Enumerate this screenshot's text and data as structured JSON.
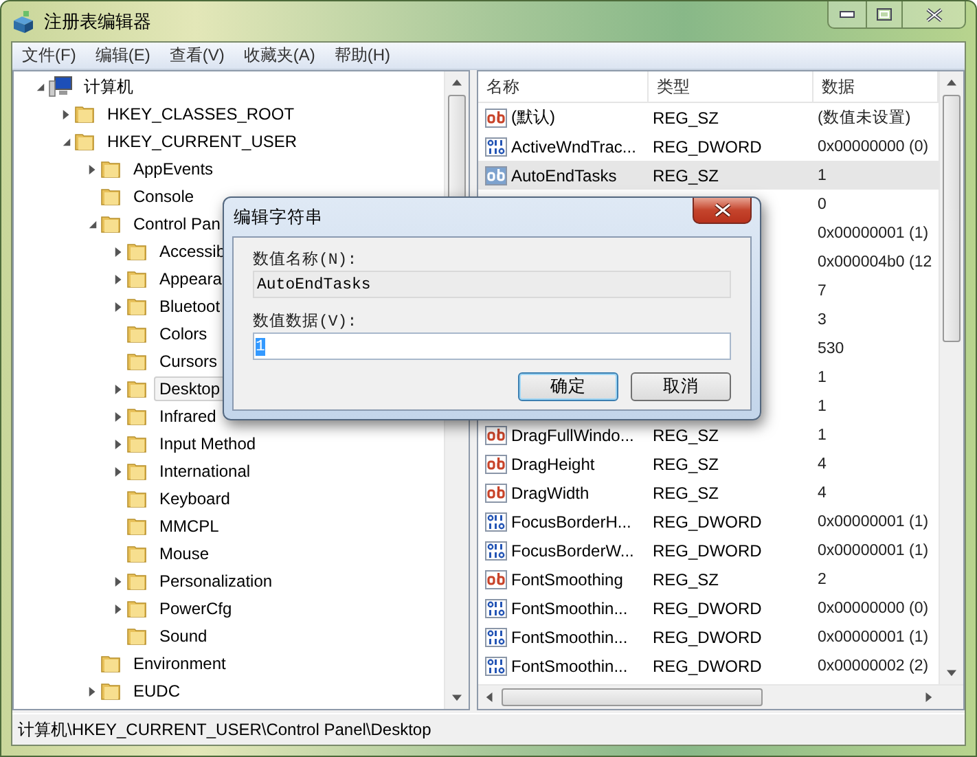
{
  "window": {
    "title": "注册表编辑器"
  },
  "menu": [
    "文件(F)",
    "编辑(E)",
    "查看(V)",
    "收藏夹(A)",
    "帮助(H)"
  ],
  "tree": [
    {
      "label": "计算机",
      "kind": "computer",
      "expanded": true,
      "selected": false,
      "children": [
        {
          "label": "HKEY_CLASSES_ROOT",
          "kind": "folder",
          "expanded": false,
          "selected": false
        },
        {
          "label": "HKEY_CURRENT_USER",
          "kind": "folder",
          "expanded": true,
          "selected": false,
          "children": [
            {
              "label": "AppEvents",
              "kind": "folder",
              "expanded": false,
              "selected": false
            },
            {
              "label": "Console",
              "kind": "folder",
              "selected": false
            },
            {
              "label": "Control Pan",
              "kind": "folder",
              "expanded": true,
              "selected": false,
              "children": [
                {
                  "label": "Accessib",
                  "kind": "folder",
                  "expanded": false,
                  "selected": false
                },
                {
                  "label": "Appeara",
                  "kind": "folder",
                  "expanded": false,
                  "selected": false
                },
                {
                  "label": "Bluetoot",
                  "kind": "folder",
                  "expanded": false,
                  "selected": false
                },
                {
                  "label": "Colors",
                  "kind": "folder",
                  "selected": false
                },
                {
                  "label": "Cursors",
                  "kind": "folder",
                  "selected": false
                },
                {
                  "label": "Desktop",
                  "kind": "folder",
                  "expanded": false,
                  "selected": true
                },
                {
                  "label": "Infrared",
                  "kind": "folder",
                  "expanded": false,
                  "selected": false
                },
                {
                  "label": "Input Method",
                  "kind": "folder",
                  "expanded": false,
                  "selected": false
                },
                {
                  "label": "International",
                  "kind": "folder",
                  "expanded": false,
                  "selected": false
                },
                {
                  "label": "Keyboard",
                  "kind": "folder",
                  "selected": false
                },
                {
                  "label": "MMCPL",
                  "kind": "folder",
                  "selected": false
                },
                {
                  "label": "Mouse",
                  "kind": "folder",
                  "selected": false
                },
                {
                  "label": "Personalization",
                  "kind": "folder",
                  "expanded": false,
                  "selected": false
                },
                {
                  "label": "PowerCfg",
                  "kind": "folder",
                  "expanded": false,
                  "selected": false
                },
                {
                  "label": "Sound",
                  "kind": "folder",
                  "selected": false
                }
              ]
            },
            {
              "label": "Environment",
              "kind": "folder",
              "selected": false
            },
            {
              "label": "EUDC",
              "kind": "folder",
              "expanded": false,
              "selected": false
            }
          ]
        }
      ]
    }
  ],
  "columns": [
    "名称",
    "类型",
    "数据"
  ],
  "rows": [
    {
      "kind": "string",
      "name": "(默认)",
      "type": "REG_SZ",
      "data": "(数值未设置)",
      "selected": false
    },
    {
      "kind": "dword",
      "name": "ActiveWndTrac...",
      "type": "REG_DWORD",
      "data": "0x00000000 (0)",
      "selected": false
    },
    {
      "kind": "string",
      "name": "AutoEndTasks",
      "type": "REG_SZ",
      "data": "1",
      "selected": true
    },
    {
      "data": "0",
      "selected": false
    },
    {
      "data": "0x00000001 (1)",
      "selected": false
    },
    {
      "data": "0x000004b0 (12",
      "selected": false
    },
    {
      "data": "7",
      "selected": false
    },
    {
      "data": "3",
      "selected": false
    },
    {
      "data": "530",
      "selected": false
    },
    {
      "data": "1",
      "selected": false
    },
    {
      "data": "1",
      "selected": false
    },
    {
      "kind": "string",
      "name": "DragFullWindo...",
      "type": "REG_SZ",
      "data": "1",
      "selected": false
    },
    {
      "kind": "string",
      "name": "DragHeight",
      "type": "REG_SZ",
      "data": "4",
      "selected": false
    },
    {
      "kind": "string",
      "name": "DragWidth",
      "type": "REG_SZ",
      "data": "4",
      "selected": false
    },
    {
      "kind": "dword",
      "name": "FocusBorderH...",
      "type": "REG_DWORD",
      "data": "0x00000001 (1)",
      "selected": false
    },
    {
      "kind": "dword",
      "name": "FocusBorderW...",
      "type": "REG_DWORD",
      "data": "0x00000001 (1)",
      "selected": false
    },
    {
      "kind": "string",
      "name": "FontSmoothing",
      "type": "REG_SZ",
      "data": "2",
      "selected": false
    },
    {
      "kind": "dword",
      "name": "FontSmoothin...",
      "type": "REG_DWORD",
      "data": "0x00000000 (0)",
      "selected": false
    },
    {
      "kind": "dword",
      "name": "FontSmoothin...",
      "type": "REG_DWORD",
      "data": "0x00000001 (1)",
      "selected": false
    },
    {
      "kind": "dword",
      "name": "FontSmoothin...",
      "type": "REG_DWORD",
      "data": "0x00000002 (2)",
      "selected": false
    }
  ],
  "status_bar": "计算机\\HKEY_CURRENT_USER\\Control Panel\\Desktop",
  "dialog": {
    "title": "编辑字符串",
    "name_label": "数值名称(N):",
    "name_value": "AutoEndTasks",
    "data_label": "数值数据(V):",
    "data_value": "1",
    "buttons": [
      {
        "label": "确定",
        "default": true
      },
      {
        "label": "取消",
        "default": false
      }
    ]
  }
}
